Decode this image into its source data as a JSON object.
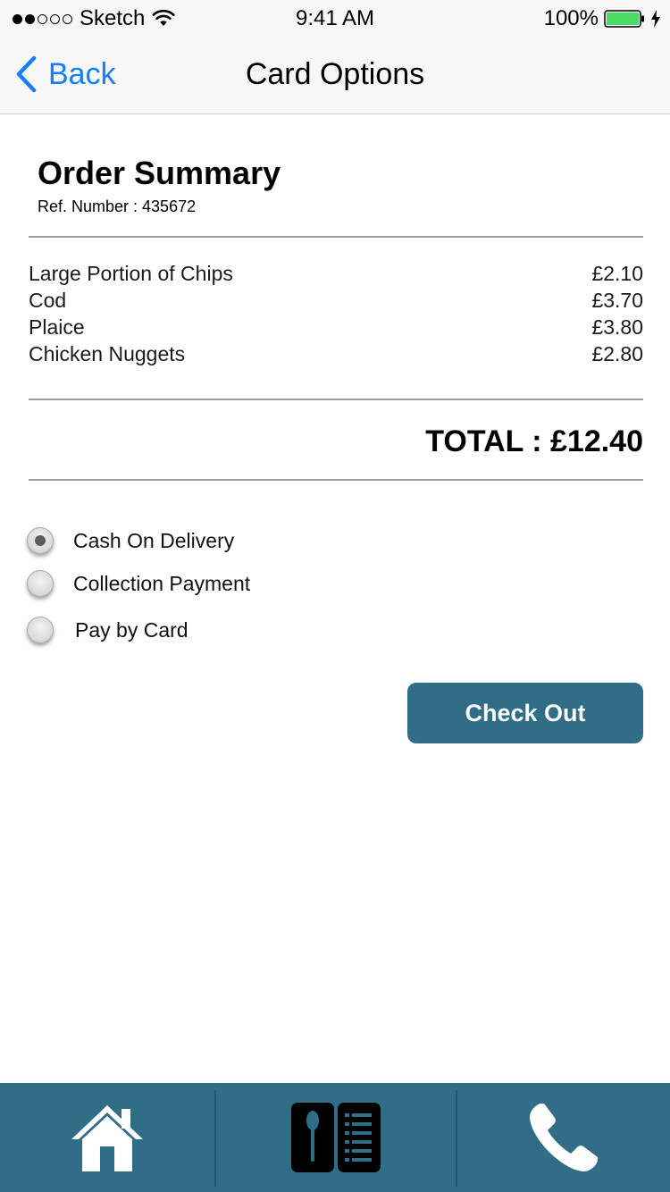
{
  "status_bar": {
    "carrier": "Sketch",
    "time": "9:41 AM",
    "battery": "100%",
    "battery_color": "#4cd964"
  },
  "nav": {
    "back_label": "Back",
    "title": "Card Options",
    "tint": "#157efb"
  },
  "summary": {
    "title": "Order Summary",
    "ref_number": "Ref. Number : 435672",
    "items": [
      {
        "name": "Large Portion of Chips",
        "price": "£2.10"
      },
      {
        "name": "Cod",
        "price": "£3.70"
      },
      {
        "name": "Plaice",
        "price": "£3.80"
      },
      {
        "name": "Chicken Nuggets",
        "price": "£2.80"
      }
    ],
    "total": "TOTAL : £12.40"
  },
  "payment_options": [
    {
      "label": "Cash On Delivery",
      "selected": true
    },
    {
      "label": "Collection Payment",
      "selected": false
    },
    {
      "label": "Pay by Card",
      "selected": false
    }
  ],
  "checkout_label": "Check Out",
  "tab_bar": {
    "background": "#2f6e86",
    "tabs": [
      {
        "icon": "home-icon"
      },
      {
        "icon": "menu-icon"
      },
      {
        "icon": "phone-icon"
      }
    ]
  }
}
